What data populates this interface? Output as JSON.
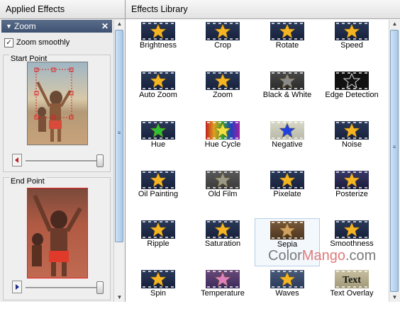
{
  "left_panel": {
    "header": "Applied Effects",
    "effect_title": "Zoom",
    "close_glyph": "✕",
    "zoom_smoothly": {
      "label": "Zoom smoothly",
      "checked": true
    },
    "start_point": {
      "label": "Start Point",
      "slider_level": 1.0
    },
    "end_point": {
      "label": "End Point",
      "slider_level": 1.0
    }
  },
  "right_panel": {
    "header": "Effects Library",
    "effects": [
      {
        "label": "Brightness",
        "icon": "brightness-icon"
      },
      {
        "label": "Crop",
        "icon": "crop-icon"
      },
      {
        "label": "Rotate",
        "icon": "rotate-icon"
      },
      {
        "label": "Speed",
        "icon": "speed-icon"
      },
      {
        "label": "Auto Zoom",
        "icon": "auto-zoom-icon"
      },
      {
        "label": "Zoom",
        "icon": "zoom-icon"
      },
      {
        "label": "Black & White",
        "icon": "black-white-icon"
      },
      {
        "label": "Edge Detection",
        "icon": "edge-detection-icon"
      },
      {
        "label": "Hue",
        "icon": "hue-icon"
      },
      {
        "label": "Hue Cycle",
        "icon": "hue-cycle-icon"
      },
      {
        "label": "Negative",
        "icon": "negative-icon"
      },
      {
        "label": "Noise",
        "icon": "noise-icon"
      },
      {
        "label": "Oil Painting",
        "icon": "oil-painting-icon"
      },
      {
        "label": "Old Film",
        "icon": "old-film-icon"
      },
      {
        "label": "Pixelate",
        "icon": "pixelate-icon"
      },
      {
        "label": "Posterize",
        "icon": "posterize-icon"
      },
      {
        "label": "Ripple",
        "icon": "ripple-icon"
      },
      {
        "label": "Saturation",
        "icon": "saturation-icon"
      },
      {
        "label": "Sepia",
        "icon": "sepia-icon",
        "selected": true
      },
      {
        "label": "Smoothness",
        "icon": "smoothness-icon"
      },
      {
        "label": "Spin",
        "icon": "spin-icon"
      },
      {
        "label": "Temperature",
        "icon": "temperature-icon"
      },
      {
        "label": "Waves",
        "icon": "waves-icon"
      },
      {
        "label": "Text Overlay",
        "icon": "text-overlay-icon",
        "overlay_text": "Text"
      }
    ]
  },
  "watermark": {
    "part1": "Color",
    "part2": "Mango",
    "part3": ".com"
  },
  "colors": {
    "panel_header_bar": "#4a5e7e",
    "star_gold": "#f5b422",
    "selection_border": "#b6cfe8"
  }
}
